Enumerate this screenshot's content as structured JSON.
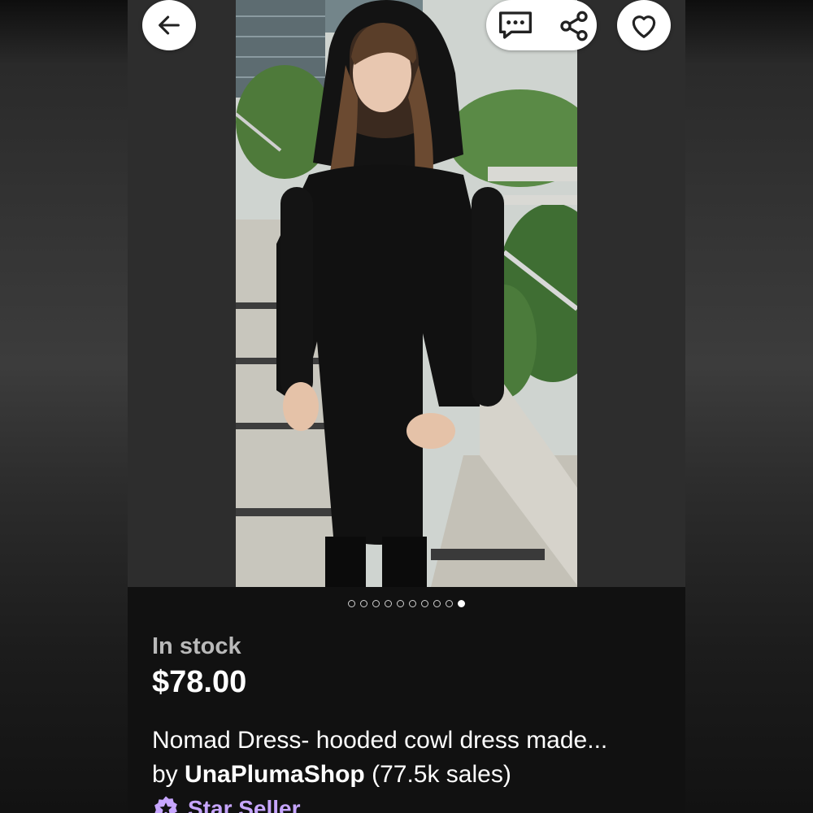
{
  "navigation": {
    "back_icon": "arrow-left-icon",
    "message_icon": "chat-ellipsis-icon",
    "share_icon": "share-nodes-icon",
    "favorite_icon": "heart-outline-icon"
  },
  "gallery": {
    "image_count": 10,
    "active_index": 9
  },
  "listing": {
    "stock_status": "In stock",
    "price": "$78.00",
    "title": "Nomad Dress- hooded cowl dress made...",
    "by_prefix": "by",
    "shop_name": "UnaPlumaShop",
    "sales_count": "(77.5k sales)",
    "badge_label": "Star Seller",
    "badge_icon": "star-badge-icon"
  },
  "colors": {
    "background": "#111111",
    "badge": "#c7a6ff",
    "stock_text": "#b9b9b9"
  }
}
